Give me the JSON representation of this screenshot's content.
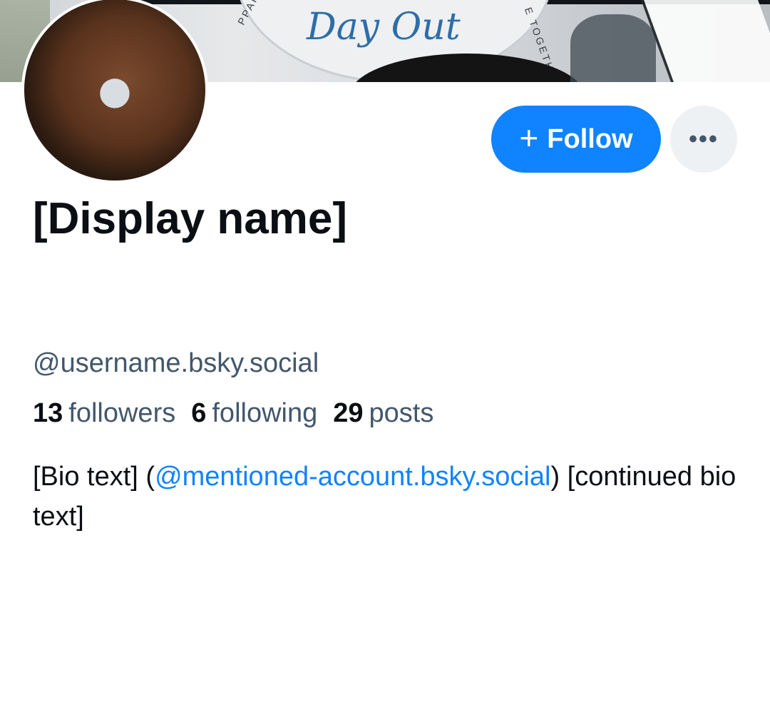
{
  "banner": {
    "script_text": "Day Out",
    "arc_left_text": "PPARENTI",
    "arc_right_text": "E TOGETH"
  },
  "profile": {
    "display_name": "[Display name]",
    "handle": "@username.bsky.social",
    "follow_label": "Follow",
    "more_label": "•••",
    "bio_line_start": "[Bio text] (",
    "bio_mention": "@mentioned-account.bsky.social",
    "bio_line_end": ") [continued bio text]"
  },
  "stats": [
    {
      "count": "13",
      "label": "followers"
    },
    {
      "count": "6",
      "label": "following"
    },
    {
      "count": "29",
      "label": "posts"
    }
  ],
  "colors": {
    "accent": "#1083fe",
    "text_primary": "#0b0f14",
    "text_secondary": "#42576c",
    "more_button_bg": "#eef1f4"
  },
  "icons": {
    "follow": "plus-icon",
    "more": "ellipsis-icon"
  }
}
